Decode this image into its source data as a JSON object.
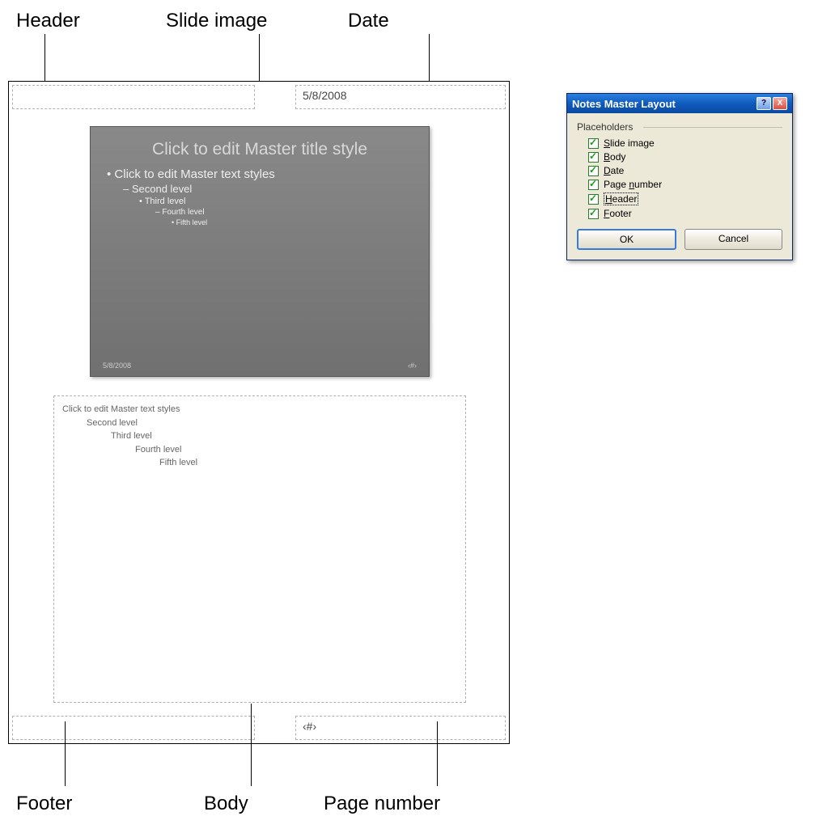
{
  "callouts": {
    "top": {
      "header": "Header",
      "slide_image": "Slide image",
      "date": "Date"
    },
    "bottom": {
      "footer": "Footer",
      "body": "Body",
      "page_number": "Page number"
    }
  },
  "page": {
    "date_value": "5/8/2008",
    "pagenum_value": "‹#›"
  },
  "slide": {
    "title": "Click to edit Master title style",
    "bullet1": "• Click to edit Master text styles",
    "bullet2": "– Second level",
    "bullet3": "• Third level",
    "bullet4": "– Fourth level",
    "bullet5": "• Fifth level",
    "footer_date": "5/8/2008",
    "footer_num": "‹#›"
  },
  "body": {
    "l1": "Click to edit Master text styles",
    "l2": "Second level",
    "l3": "Third level",
    "l4": "Fourth level",
    "l5": "Fifth level"
  },
  "dialog": {
    "title": "Notes Master Layout",
    "group_label": "Placeholders",
    "items": {
      "slide_image_pre": "",
      "slide_image_u": "S",
      "slide_image_post": "lide image",
      "body_u": "B",
      "body_post": "ody",
      "date_u": "D",
      "date_post": "ate",
      "pagenum_pre": "Page ",
      "pagenum_u": "n",
      "pagenum_post": "umber",
      "header_u": "H",
      "header_post": "eader",
      "footer_u": "F",
      "footer_post": "ooter"
    },
    "buttons": {
      "ok": "OK",
      "cancel": "Cancel"
    },
    "titlebar": {
      "help": "?",
      "close": "X"
    }
  }
}
